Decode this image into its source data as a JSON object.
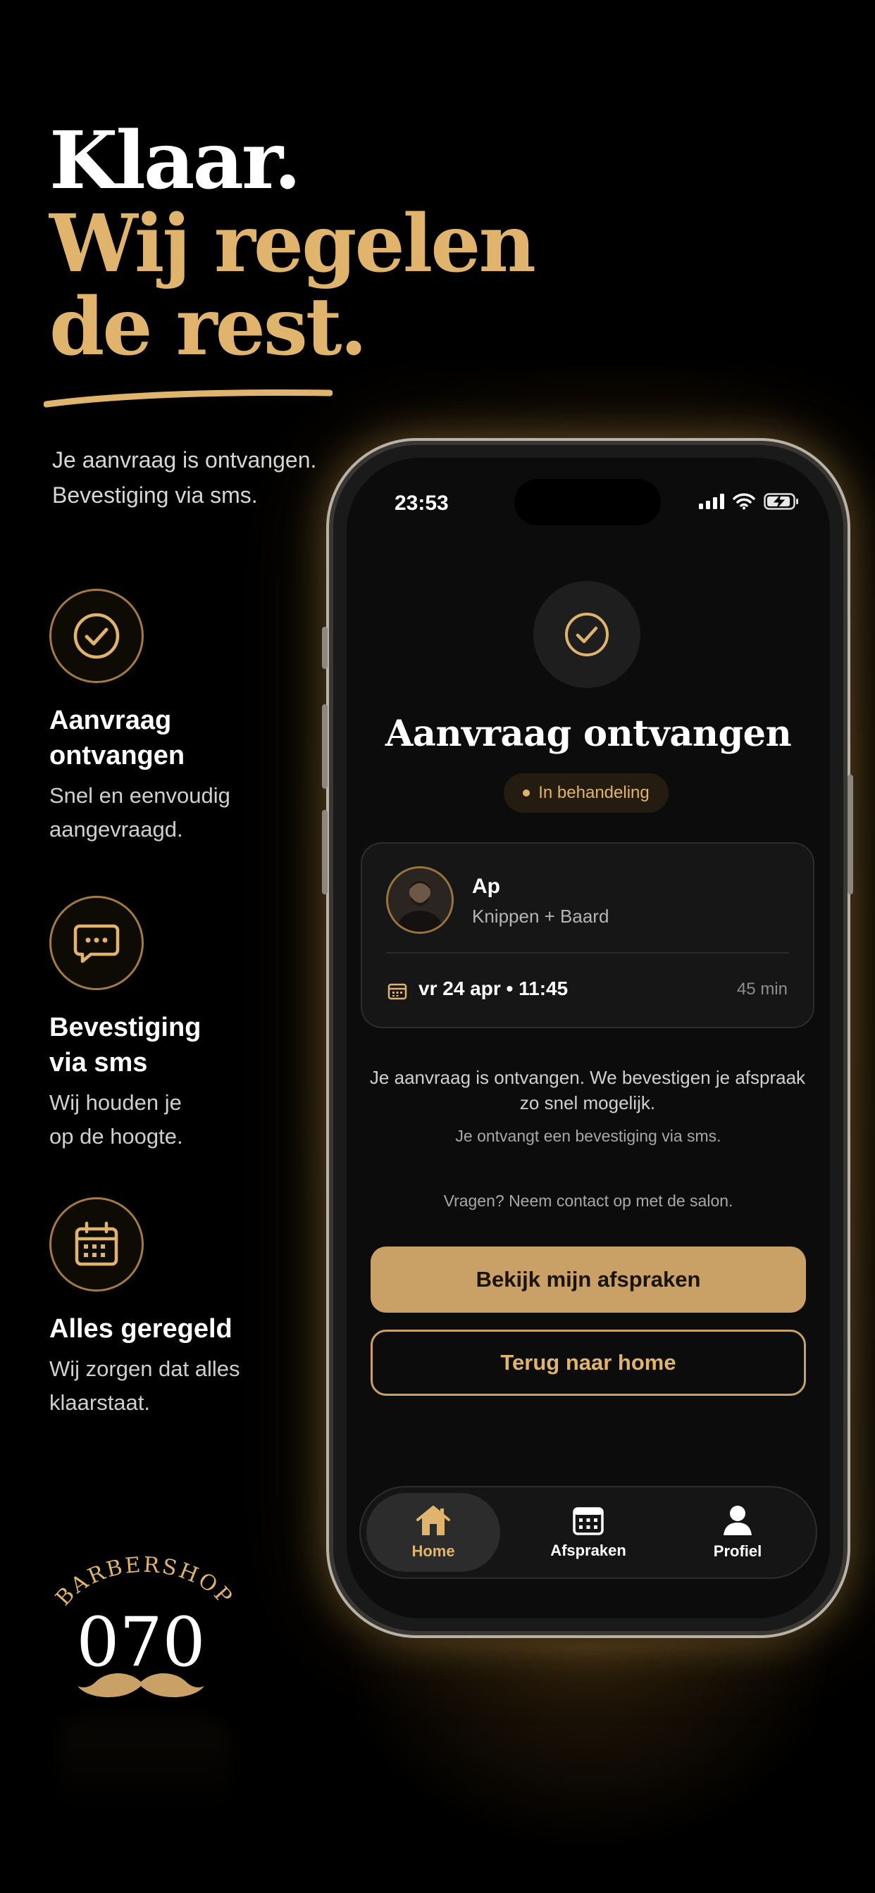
{
  "hero": {
    "line1": "Klaar.",
    "line2": "Wij regelen",
    "line3": "de rest.",
    "subtitle_line1": "Je aanvraag is ontvangen.",
    "subtitle_line2": "Bevestiging via sms."
  },
  "features": [
    {
      "icon": "check-circle-icon",
      "title_line1": "Aanvraag",
      "title_line2": "ontvangen",
      "desc_line1": "Snel en eenvoudig",
      "desc_line2": "aangevraagd."
    },
    {
      "icon": "chat-bubble-icon",
      "title_line1": "Bevestiging",
      "title_line2": "via sms",
      "desc_line1": "Wij houden je",
      "desc_line2": "op de hoogte."
    },
    {
      "icon": "calendar-icon",
      "title_line1": "Alles geregeld",
      "title_line2": "",
      "desc_line1": "Wij zorgen dat alles",
      "desc_line2": "klaarstaat."
    }
  ],
  "logo": {
    "top_text": "BARBERSHOP",
    "number": "070",
    "icon": "mustache-icon"
  },
  "phone": {
    "status": {
      "time": "23:53"
    },
    "title": "Aanvraag ontvangen",
    "badge": "In behandeling",
    "booking": {
      "name": "Ap",
      "service": "Knippen + Baard",
      "datetime": "vr 24 apr • 11:45",
      "duration": "45 min"
    },
    "message_line1": "Je aanvraag is ontvangen. We bevestigen je afspraak",
    "message_line2": "zo snel mogelijk.",
    "sms_note": "Je ontvangt een bevestiging via sms.",
    "contact_note": "Vragen? Neem contact op met de salon.",
    "primary_button": "Bekijk mijn afspraken",
    "secondary_button": "Terug naar home",
    "tabs": [
      {
        "label": "Home",
        "icon": "home-icon",
        "active": true
      },
      {
        "label": "Afspraken",
        "icon": "calendar-icon",
        "active": false
      },
      {
        "label": "Profiel",
        "icon": "person-icon",
        "active": false
      }
    ]
  },
  "colors": {
    "gold": "#e0b46c",
    "button_gold": "#c9a066",
    "background": "#000000"
  }
}
